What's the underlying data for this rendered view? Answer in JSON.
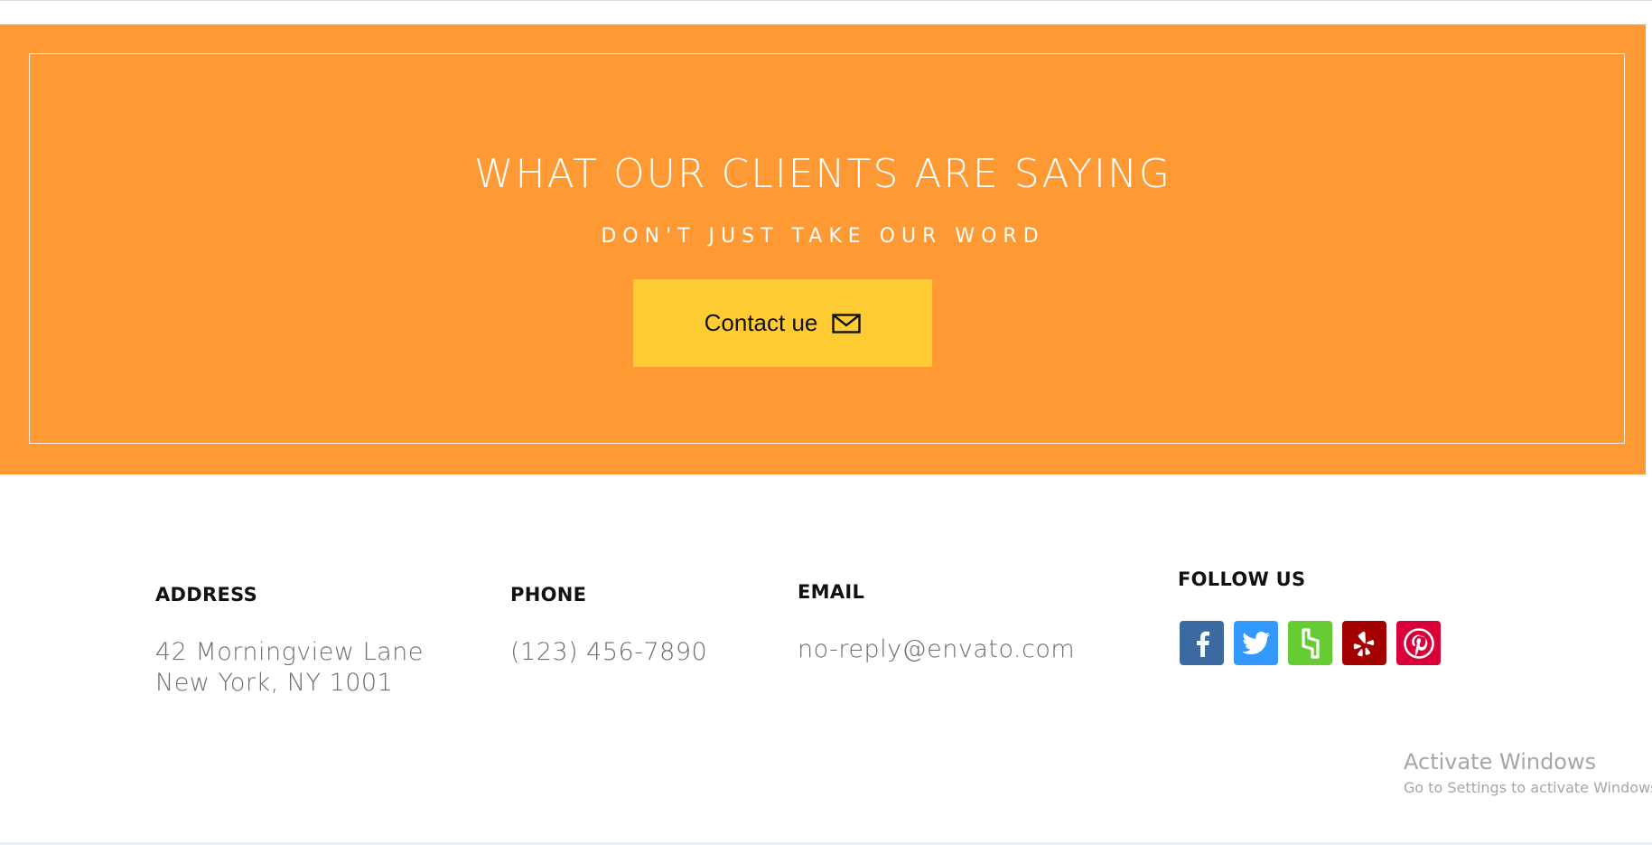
{
  "hero": {
    "title": "WHAT OUR CLIENTS ARE SAYING",
    "subtitle": "DON'T JUST TAKE OUR WORD",
    "contact_button_label": "Contact ue",
    "contact_icon": "envelope-icon",
    "background_color": "#ff9933",
    "button_color": "#ffcc33"
  },
  "footer": {
    "address": {
      "heading": "ADDRESS",
      "line1": "42 Morningview Lane",
      "line2": "New York, NY 1001"
    },
    "phone": {
      "heading": "PHONE",
      "value": "(123) 456-7890"
    },
    "email": {
      "heading": "EMAIL",
      "value": "no-reply@envato.com"
    },
    "follow": {
      "heading": "FOLLOW US",
      "icons": [
        {
          "name": "facebook-icon",
          "color": "#3b6aa0"
        },
        {
          "name": "twitter-icon",
          "color": "#3399ff"
        },
        {
          "name": "houzz-icon",
          "color": "#66cc33"
        },
        {
          "name": "yelp-icon",
          "color": "#a30000"
        },
        {
          "name": "pinterest-icon",
          "color": "#d9003a"
        }
      ]
    }
  },
  "watermark": {
    "line1": "Activate Windows",
    "line2": "Go to Settings to activate Windows."
  }
}
